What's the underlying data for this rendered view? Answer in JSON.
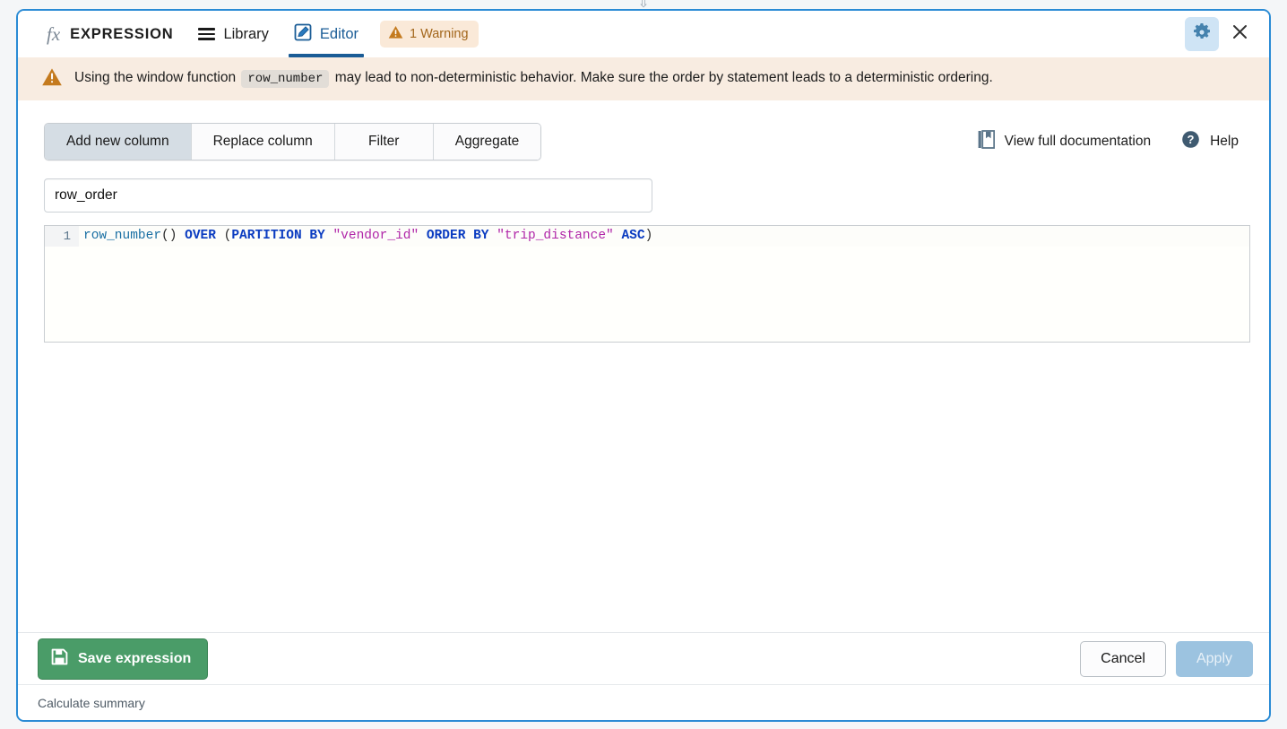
{
  "window": {
    "drag_arrow": "⇩",
    "accent_color": "#2a8bd5"
  },
  "header": {
    "fx_glyph": "fx",
    "title": "EXPRESSION",
    "library_label": "Library",
    "editor_label": "Editor",
    "warning_badge": "1 Warning",
    "gear_icon": "gear-icon",
    "close_icon": "close-icon"
  },
  "banner": {
    "icon": "warning-triangle-icon",
    "text_before": "Using the window function",
    "code_chip": "row_number",
    "text_after": "may lead to non-deterministic behavior. Make sure the order by statement leads to a deterministic ordering.",
    "background": "#f8ece1"
  },
  "toolbar": {
    "segments": [
      {
        "label": "Add new column",
        "selected": true
      },
      {
        "label": "Replace column",
        "selected": false
      },
      {
        "label": "Filter",
        "selected": false
      },
      {
        "label": "Aggregate",
        "selected": false
      }
    ],
    "documentation_label": "View full documentation",
    "documentation_icon": "book-icon",
    "help_label": "Help",
    "help_icon": "question-circle-icon"
  },
  "name_field": {
    "value": "row_order",
    "placeholder": "Column name"
  },
  "editor": {
    "line_number": "1",
    "tokens": [
      {
        "text": "row_number",
        "type": "fn"
      },
      {
        "text": "()",
        "type": "punc"
      },
      {
        "text": " ",
        "type": "punc"
      },
      {
        "text": "OVER",
        "type": "kw"
      },
      {
        "text": " (",
        "type": "punc"
      },
      {
        "text": "PARTITION BY",
        "type": "kw"
      },
      {
        "text": " ",
        "type": "punc"
      },
      {
        "text": "\"vendor_id\"",
        "type": "str"
      },
      {
        "text": " ",
        "type": "punc"
      },
      {
        "text": "ORDER BY",
        "type": "kw"
      },
      {
        "text": " ",
        "type": "punc"
      },
      {
        "text": "\"trip_distance\"",
        "type": "str"
      },
      {
        "text": " ",
        "type": "punc"
      },
      {
        "text": "ASC",
        "type": "kw"
      },
      {
        "text": ")",
        "type": "punc"
      }
    ],
    "full_text": "row_number() OVER (PARTITION BY \"vendor_id\" ORDER BY \"trip_distance\" ASC)"
  },
  "footer": {
    "save_label": "Save expression",
    "save_icon": "floppy-disk-icon",
    "cancel_label": "Cancel",
    "apply_label": "Apply",
    "apply_disabled": true
  },
  "statusbar": {
    "text": "Calculate summary"
  }
}
